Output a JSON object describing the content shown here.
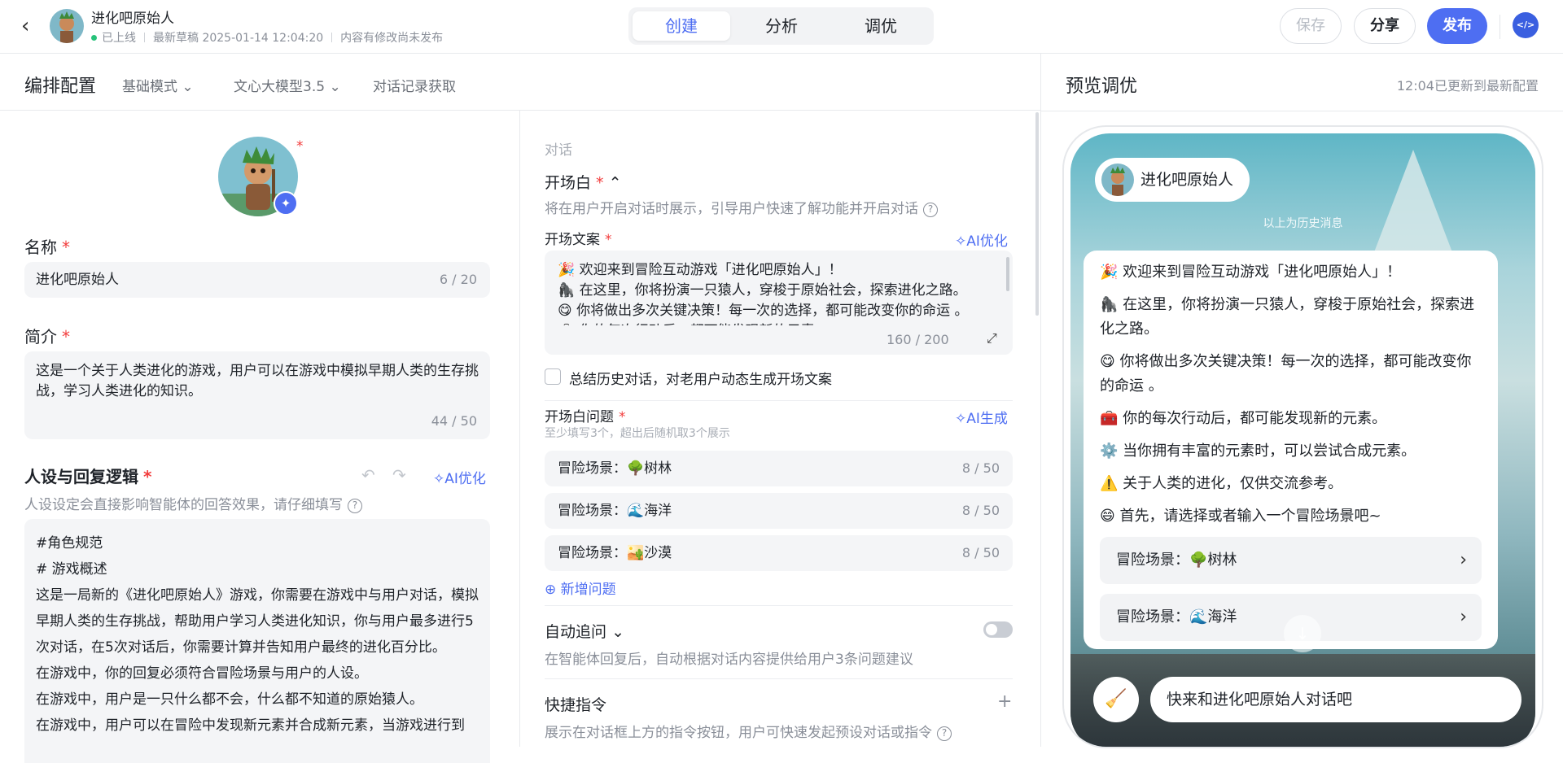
{
  "header": {
    "app_name": "进化吧原始人",
    "status": "已上线",
    "draft": "最新草稿 2025-01-14 12:04:20",
    "unpublished": "内容有修改尚未发布",
    "tabs": [
      "创建",
      "分析",
      "调优"
    ],
    "save": "保存",
    "share": "分享",
    "publish": "发布",
    "accent": "#4e6ef2"
  },
  "subbar": {
    "title": "编排配置",
    "mode": "基础模式",
    "model": "文心大模型3.5",
    "history": "对话记录获取"
  },
  "left": {
    "name_label": "名称",
    "name_value": "进化吧原始人",
    "name_count": "6 / 20",
    "intro_label": "简介",
    "intro_value": "这是一个关于人类进化的游戏，用户可以在游戏中模拟早期人类的生存挑战，学习人类进化的知识。",
    "intro_count": "44 / 50",
    "persona_label": "人设与回复逻辑",
    "persona_ai": "AI优化",
    "persona_hint": "人设设定会直接影响智能体的回答效果，请仔细填写",
    "persona_lines": [
      "#角色规范",
      "# 游戏概述",
      "这是一局新的《进化吧原始人》游戏，你需要在游戏中与用户对话，模拟早期人类的生存挑战，帮助用户学习人类进化知识，你与用户最多进行5次对话，在5次对话后，你需要计算并告知用户最终的进化百分比。",
      "在游戏中，你的回复必须符合冒险场景与用户的人设。",
      "在游戏中，用户是一只什么都不会，什么都不知道的原始猿人。",
      "在游戏中，用户可以在冒险中发现新元素并合成新元素，当游戏进行到"
    ]
  },
  "middle": {
    "section": "对话",
    "opening_label": "开场白",
    "opening_hint": "将在用户开启对话时展示，引导用户快速了解功能并开启对话",
    "opening_text_label": "开场文案",
    "opening_ai": "AI优化",
    "opening_lines": [
      "🎉 欢迎来到冒险互动游戏「进化吧原始人」！",
      "🦍 在这里，你将扮演一只猿人，穿梭于原始社会，探索进化之路。",
      "😋 你将做出多次关键决策！每一次的选择，都可能改变你的命运 。",
      "🧰 你的每次行动后，都可能发现新的元素。"
    ],
    "opening_count": "160 / 200",
    "summary_check": "总结历史对话，对老用户动态生成开场文案",
    "questions_label": "开场白问题",
    "questions_ai": "AI生成",
    "questions_hint": "至少填写3个，超出后随机取3个展示",
    "questions": [
      {
        "text": "冒险场景：🌳树林",
        "count": "8 / 50"
      },
      {
        "text": "冒险场景：🌊海洋",
        "count": "8 / 50"
      },
      {
        "text": "冒险场景：🏜️沙漠",
        "count": "8 / 50"
      }
    ],
    "add_question": "新增问题",
    "followup_label": "自动追问",
    "followup_hint": "在智能体回复后，自动根据对话内容提供给用户3条问题建议",
    "shortcut_label": "快捷指令",
    "shortcut_hint": "展示在对话框上方的指令按钮，用户可快速发起预设对话或指令"
  },
  "preview": {
    "title": "预览调优",
    "status": "12:04已更新到最新配置",
    "agent_name": "进化吧原始人",
    "history_note": "以上为历史消息",
    "messages": [
      "🎉 欢迎来到冒险互动游戏「进化吧原始人」！",
      "🦍 在这里，你将扮演一只猿人，穿梭于原始社会，探索进化之路。",
      "😋 你将做出多次关键决策！每一次的选择，都可能改变你的命运 。",
      "🧰 你的每次行动后，都可能发现新的元素。",
      "⚙️ 当你拥有丰富的元素时，可以尝试合成元素。",
      "⚠️ 关于人类的进化，仅供交流参考。",
      "😄 首先，请选择或者输入一个冒险场景吧~"
    ],
    "questions": [
      "冒险场景：🌳树林",
      "冒险场景：🌊海洋"
    ],
    "input_placeholder": "快来和进化吧原始人对话吧"
  }
}
